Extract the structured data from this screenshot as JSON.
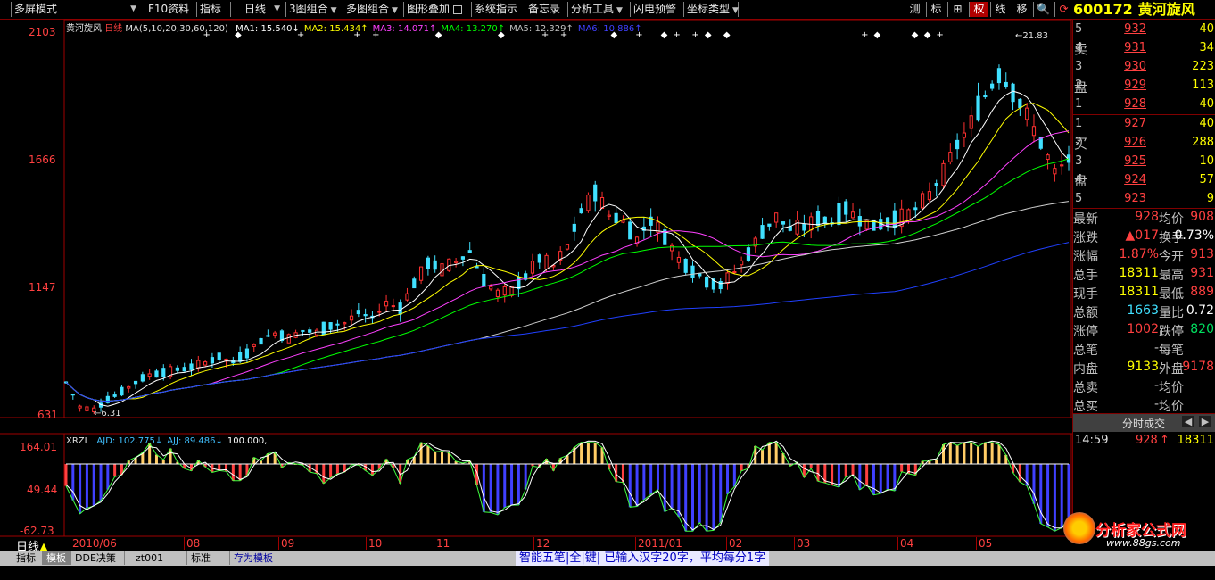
{
  "toolbar": {
    "items": [
      "多屏模式",
      "F10资料",
      "指标",
      "日线",
      "3图组合",
      "多图组合",
      "图形叠加",
      "系统指示",
      "备忘录",
      "分析工具",
      "闪电预警",
      "坐标类型"
    ],
    "right_buttons": [
      "测",
      "标",
      "⊞",
      "权",
      "线",
      "移"
    ],
    "active_right": "权"
  },
  "stock": {
    "code": "600172",
    "name": "黄河旋风"
  },
  "main_chart": {
    "name": "黄河旋风",
    "period": "日线",
    "ma_params": "MA(5,10,20,30,60,120)",
    "ma_legend": [
      {
        "label": "MA1: 15.540",
        "arrow": "↓",
        "color": "#ffffff"
      },
      {
        "label": "MA2: 15.434",
        "arrow": "↑",
        "color": "#ffff00"
      },
      {
        "label": "MA3: 14.071",
        "arrow": "↑",
        "color": "#ff40ff"
      },
      {
        "label": "MA4: 13.270",
        "arrow": "↑",
        "color": "#00ff00"
      },
      {
        "label": "MA5: 12.329",
        "arrow": "↑",
        "color": "#c0c0c0"
      },
      {
        "label": "MA6: 10.886",
        "arrow": "↑",
        "color": "#4040ff"
      }
    ],
    "y_ticks": [
      "2103",
      "1666",
      "1147",
      "631"
    ],
    "high_label": "21.83",
    "low_label": "6.31"
  },
  "sub_chart": {
    "name": "XRZL",
    "legend": [
      {
        "label": "AJD: 102.775",
        "arrow": "↓",
        "color": "#40c0ff"
      },
      {
        "label": "AJJ: 89.486",
        "arrow": "↓",
        "color": "#40c0ff"
      },
      {
        "label": "100.000,",
        "arrow": "",
        "color": "#ffffff"
      }
    ],
    "y_ticks": [
      "164.01",
      "49.44",
      "-62.73"
    ]
  },
  "x_axis": {
    "period_label": "日线",
    "labels": [
      "2010/06",
      "08",
      "09",
      "10",
      "11",
      "12",
      "2011/01",
      "02",
      "03",
      "04",
      "05"
    ]
  },
  "chart_data": {
    "type": "candlestick",
    "title": "黄河旋风",
    "x_labels": [
      "2010/06",
      "08",
      "09",
      "10",
      "11",
      "12",
      "2011/01",
      "02",
      "03",
      "04",
      "05"
    ],
    "ylim": [
      6.31,
      21.83
    ],
    "y_ticks": [
      "2103",
      "1666",
      "1147",
      "631"
    ],
    "close_path": [
      [
        0,
        7.6
      ],
      [
        2,
        6.6
      ],
      [
        4,
        6.5
      ],
      [
        6,
        6.9
      ],
      [
        8,
        7.2
      ],
      [
        10,
        7.6
      ],
      [
        12,
        7.9
      ],
      [
        14,
        8.0
      ],
      [
        16,
        8.1
      ],
      [
        18,
        8.2
      ],
      [
        20,
        8.4
      ],
      [
        22,
        8.6
      ],
      [
        24,
        8.4
      ],
      [
        26,
        8.8
      ],
      [
        28,
        9.3
      ],
      [
        30,
        9.6
      ],
      [
        32,
        9.4
      ],
      [
        34,
        9.7
      ],
      [
        36,
        9.6
      ],
      [
        38,
        9.9
      ],
      [
        40,
        10.0
      ],
      [
        42,
        10.4
      ],
      [
        44,
        10.2
      ],
      [
        46,
        10.8
      ],
      [
        48,
        10.6
      ],
      [
        50,
        11.6
      ],
      [
        52,
        12.4
      ],
      [
        54,
        12.2
      ],
      [
        56,
        12.5
      ],
      [
        58,
        12.9
      ],
      [
        60,
        11.7
      ],
      [
        62,
        11.2
      ],
      [
        64,
        11.3
      ],
      [
        66,
        11.9
      ],
      [
        68,
        12.6
      ],
      [
        70,
        12.3
      ],
      [
        72,
        13.1
      ],
      [
        74,
        14.5
      ],
      [
        76,
        15.3
      ],
      [
        78,
        14.4
      ],
      [
        80,
        14.1
      ],
      [
        82,
        13.4
      ],
      [
        84,
        14.2
      ],
      [
        86,
        13.5
      ],
      [
        88,
        12.6
      ],
      [
        90,
        12.1
      ],
      [
        92,
        11.7
      ],
      [
        94,
        11.5
      ],
      [
        96,
        12.1
      ],
      [
        98,
        12.8
      ],
      [
        100,
        13.7
      ],
      [
        102,
        14.3
      ],
      [
        104,
        13.8
      ],
      [
        106,
        13.9
      ],
      [
        108,
        14.2
      ],
      [
        110,
        14.1
      ],
      [
        112,
        14.6
      ],
      [
        114,
        14.2
      ],
      [
        116,
        13.9
      ],
      [
        118,
        14.1
      ],
      [
        120,
        14.3
      ],
      [
        122,
        14.6
      ],
      [
        124,
        15.2
      ],
      [
        126,
        16.1
      ],
      [
        128,
        17.2
      ],
      [
        130,
        18.1
      ],
      [
        132,
        19.2
      ],
      [
        134,
        20.1
      ],
      [
        136,
        19.4
      ],
      [
        138,
        18.4
      ],
      [
        140,
        17.3
      ],
      [
        142,
        16.1
      ],
      [
        144,
        16.6
      ]
    ],
    "ma_series": [
      {
        "name": "MA1",
        "value": 15.54
      },
      {
        "name": "MA2",
        "value": 15.434
      },
      {
        "name": "MA3",
        "value": 14.071
      },
      {
        "name": "MA4",
        "value": 13.27
      },
      {
        "name": "MA5",
        "value": 12.329
      },
      {
        "name": "MA6",
        "value": 10.886
      }
    ],
    "indicator": {
      "name": "XRZL",
      "ylim": [
        -62.73,
        164.01
      ],
      "y_ticks": [
        "164.01",
        "49.44",
        "-62.73"
      ],
      "AJD": 102.775,
      "AJJ": 89.486,
      "reference": 100.0
    }
  },
  "order_book": {
    "sell_label": [
      "卖",
      "盘"
    ],
    "buy_label": [
      "买",
      "盘"
    ],
    "sells": [
      {
        "level": "5",
        "price": "932",
        "volume": "40"
      },
      {
        "level": "4",
        "price": "931",
        "volume": "34"
      },
      {
        "level": "3",
        "price": "930",
        "volume": "223"
      },
      {
        "level": "2",
        "price": "929",
        "volume": "113"
      },
      {
        "level": "1",
        "price": "928",
        "volume": "40"
      }
    ],
    "buys": [
      {
        "level": "1",
        "price": "927",
        "volume": "40"
      },
      {
        "level": "2",
        "price": "926",
        "volume": "288"
      },
      {
        "level": "3",
        "price": "925",
        "volume": "10"
      },
      {
        "level": "4",
        "price": "924",
        "volume": "57"
      },
      {
        "level": "5",
        "price": "923",
        "volume": "9"
      }
    ]
  },
  "stats": [
    {
      "l1": "最新",
      "v1": "928",
      "c1": "#ff4040",
      "l2": "均价",
      "v2": "908",
      "c2": "#ff4040"
    },
    {
      "l1": "涨跌",
      "v1": "▲017",
      "c1": "#ff4040",
      "l2": "换手",
      "v2": "0.73%",
      "c2": "#ffffff"
    },
    {
      "l1": "涨幅",
      "v1": "1.87%",
      "c1": "#ff4040",
      "l2": "今开",
      "v2": "913",
      "c2": "#ff4040"
    },
    {
      "l1": "总手",
      "v1": "18311",
      "c1": "#ffff00",
      "l2": "最高",
      "v2": "931",
      "c2": "#ff4040"
    },
    {
      "l1": "现手",
      "v1": "18311",
      "c1": "#ffff00",
      "l2": "最低",
      "v2": "889",
      "c2": "#ff4040"
    },
    {
      "l1": "总额",
      "v1": "1663",
      "c1": "#40e0ff",
      "l2": "量比",
      "v2": "0.72",
      "c2": "#ffffff"
    },
    {
      "l1": "涨停",
      "v1": "1002",
      "c1": "#ff4040",
      "l2": "跌停",
      "v2": "820",
      "c2": "#00e060"
    },
    {
      "l1": "总笔",
      "v1": "-",
      "c1": "#c0c0c0",
      "l2": "每笔",
      "v2": "",
      "c2": "#c0c0c0"
    },
    {
      "l1": "内盘",
      "v1": "9133",
      "c1": "#ffff00",
      "l2": "外盘",
      "v2": "9178",
      "c2": "#ff4040"
    },
    {
      "l1": "总卖",
      "v1": "-",
      "c1": "#c0c0c0",
      "l2": "均价",
      "v2": "",
      "c2": "#c0c0c0"
    },
    {
      "l1": "总买",
      "v1": "-",
      "c1": "#c0c0c0",
      "l2": "均价",
      "v2": "",
      "c2": "#c0c0c0"
    }
  ],
  "tick_panel": {
    "title": "分时成交",
    "time": "14:59",
    "price": "928",
    "arrow": "↑",
    "volume": "18311"
  },
  "bottom_tabs": [
    "指标",
    "模板",
    "DDE决策",
    "zt001",
    "标准",
    "存为模板"
  ],
  "active_tab": "模板",
  "status_text": "智能五笔|全|键| 已输入汉字20字，平均每分1字",
  "watermark": {
    "text": "分析家公式网",
    "url": "www.88gs.com"
  }
}
